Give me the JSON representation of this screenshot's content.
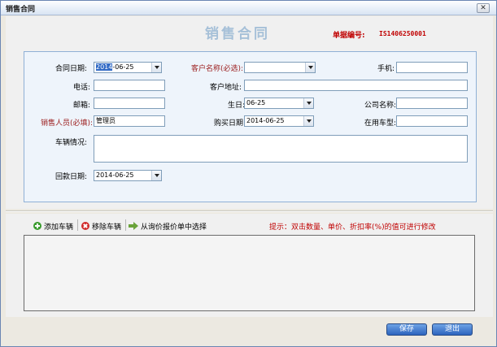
{
  "window": {
    "title": "销售合同",
    "close_glyph": "✕"
  },
  "header": {
    "title": "销售合同",
    "doc_no_label": "单据编号:",
    "doc_no_value": "IS1406250001"
  },
  "form": {
    "contract_date": {
      "label": "合同日期:",
      "value_sel": "2014",
      "value_rest": "-06-25"
    },
    "customer_name": {
      "label": "客户名称(必选):",
      "value": ""
    },
    "mobile": {
      "label": "手机:",
      "value": ""
    },
    "phone": {
      "label": "电话:",
      "value": ""
    },
    "customer_address": {
      "label": "客户地址:",
      "value": ""
    },
    "email": {
      "label": "邮箱:",
      "value": ""
    },
    "birthday": {
      "label": "生日:",
      "value": "06-25"
    },
    "company_name": {
      "label": "公司名称:",
      "value": ""
    },
    "salesperson": {
      "label": "销售人员(必填):",
      "value": "管理员"
    },
    "purchase_date": {
      "label": "购买日期:",
      "value": "2014-06-25"
    },
    "vehicle_in_use": {
      "label": "在用车型:",
      "value": ""
    },
    "vehicle_info": {
      "label": "车辆情况:",
      "value": ""
    },
    "payment_date": {
      "label": "回款日期:",
      "value": "2014-06-25"
    }
  },
  "toolbar": {
    "add_vehicle": "添加车辆",
    "remove_vehicle": "移除车辆",
    "select_from_quote": "从询价报价单中选择",
    "hint": "提示：双击数量、单价、折扣率(%)的值可进行修改"
  },
  "footer": {
    "save": "保存",
    "exit": "退出"
  },
  "colors": {
    "title_blue": "#a6c0d8",
    "required_red": "#9b1c1c",
    "button_blue": "#2d64bd"
  }
}
